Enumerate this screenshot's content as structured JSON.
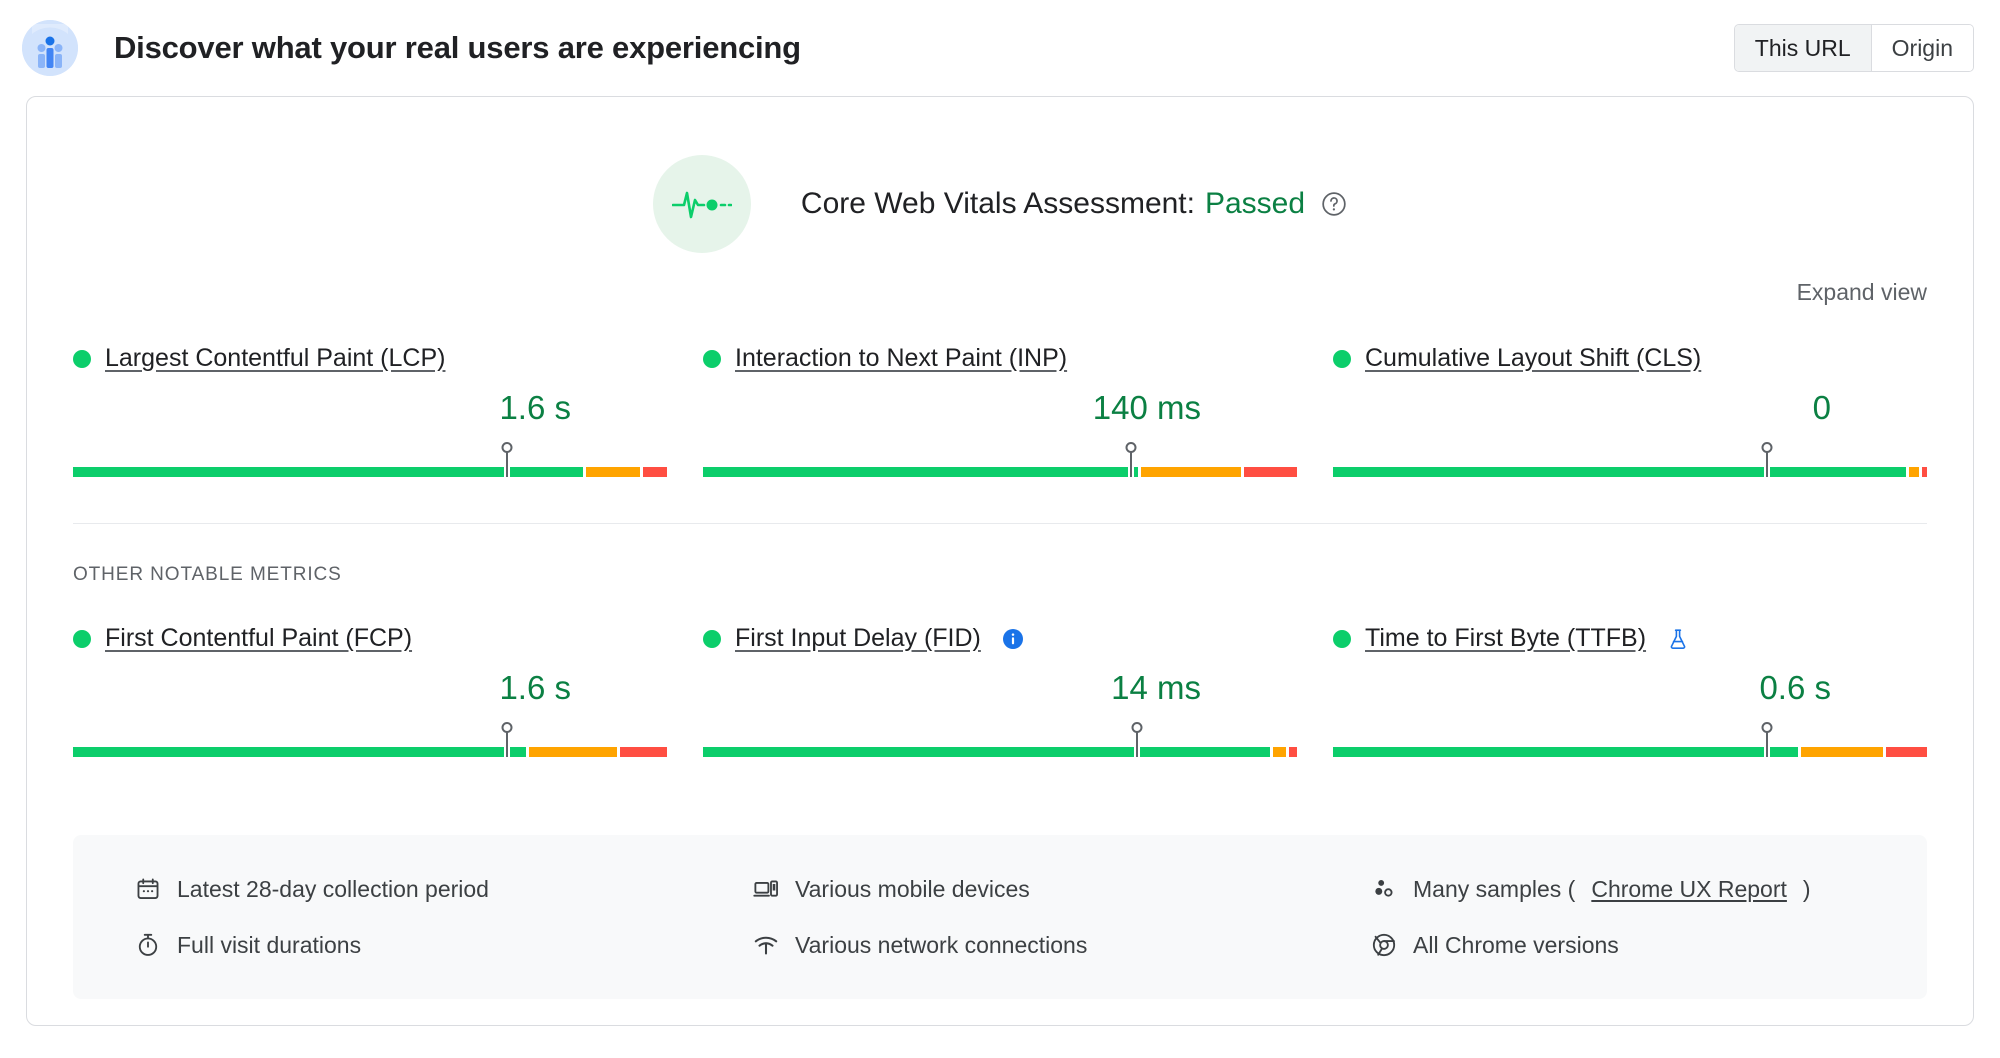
{
  "header": {
    "title": "Discover what your real users are experiencing",
    "logo_icon": "crux-users-icon",
    "toggle": {
      "name": "url-scope-toggle",
      "options": [
        {
          "label": "This URL",
          "selected": true
        },
        {
          "label": "Origin",
          "selected": false
        }
      ]
    }
  },
  "assessment": {
    "icon": "pulse-heartbeat-icon",
    "label": "Core Web Vitals Assessment:",
    "status": "Passed",
    "status_color": "#0b8043",
    "help_icon": "help-circle-icon"
  },
  "expand_view": {
    "label": "Expand view"
  },
  "section_title": "OTHER NOTABLE METRICS",
  "colors": {
    "good": "#0cce6b",
    "average": "#ffa400",
    "poor": "#ff4e42",
    "good_text": "#0b8043",
    "marker": "#5f6368"
  },
  "core_web_vitals": [
    {
      "id": "lcp",
      "name": "Largest Contentful Paint (LCP)",
      "rating": "good",
      "value": "1.6 s",
      "marker_percent": 73,
      "distribution": {
        "good": 85,
        "average": 9,
        "poor": 4
      }
    },
    {
      "id": "inp",
      "name": "Interaction to Next Paint (INP)",
      "rating": "good",
      "value": "140 ms",
      "marker_percent": 72,
      "distribution": {
        "good": 74,
        "average": 17,
        "poor": 9
      }
    },
    {
      "id": "cls",
      "name": "Cumulative Layout Shift (CLS)",
      "rating": "good",
      "value": "0",
      "marker_percent": 73,
      "distribution": {
        "good": 97,
        "average": 1.7,
        "poor": 0.9
      }
    }
  ],
  "other_metrics": [
    {
      "id": "fcp",
      "name": "First Contentful Paint (FCP)",
      "rating": "good",
      "value": "1.6 s",
      "marker_percent": 73,
      "flag_icon": null,
      "distribution": {
        "good": 77,
        "average": 15,
        "poor": 8
      }
    },
    {
      "id": "fid",
      "name": "First Input Delay (FID)",
      "rating": "good",
      "value": "14 ms",
      "marker_percent": 73,
      "flag_icon": "info-circle-icon",
      "distribution": {
        "good": 96,
        "average": 2.2,
        "poor": 1.4
      }
    },
    {
      "id": "ttfb",
      "name": "Time to First Byte (TTFB)",
      "rating": "good",
      "value": "0.6 s",
      "marker_percent": 73,
      "flag_icon": "experimental-flask-icon",
      "distribution": {
        "good": 79,
        "average": 14,
        "poor": 7
      }
    }
  ],
  "meta": {
    "columns": [
      {
        "items": [
          {
            "icon": "calendar-icon",
            "text": "Latest 28-day collection period"
          },
          {
            "icon": "stopwatch-icon",
            "text": "Full visit durations"
          }
        ]
      },
      {
        "items": [
          {
            "icon": "devices-icon",
            "text": "Various mobile devices"
          },
          {
            "icon": "network-signal-icon",
            "text": "Various network connections"
          }
        ]
      },
      {
        "items": [
          {
            "icon": "samples-dots-icon",
            "text": "Many samples (",
            "link": "Chrome UX Report",
            "text_after": ")"
          },
          {
            "icon": "chrome-logo-icon",
            "text": "All Chrome versions"
          }
        ]
      }
    ]
  }
}
